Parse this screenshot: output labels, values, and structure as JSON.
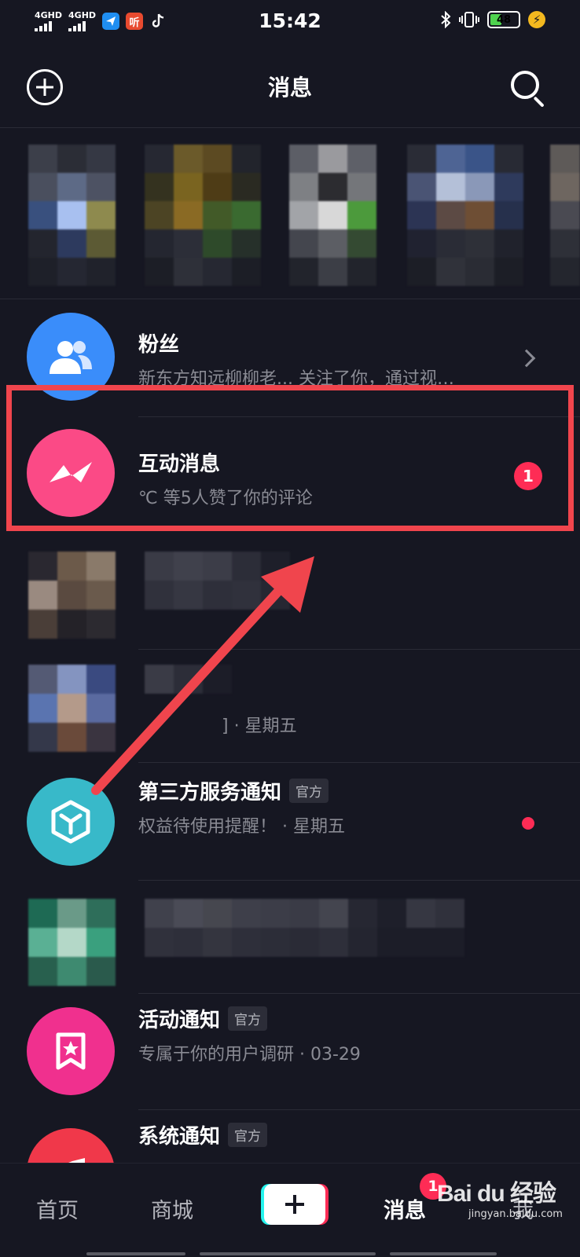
{
  "status_bar": {
    "signal_1": "4GHD",
    "signal_2": "4GHD",
    "app_badge_text": "听",
    "time": "15:42",
    "battery_level": "48",
    "battery_fraction": 0.48
  },
  "header": {
    "title": "消息"
  },
  "rows": {
    "fans": {
      "title": "粉丝",
      "subtitle": "新东方知远柳柳老... 关注了你，通过视…"
    },
    "interactions": {
      "title": "互动消息",
      "subtitle": "℃ 等5人赞了你的评论",
      "badge": "1"
    },
    "blurred_chat": {
      "subtitle": "] · 星期五"
    },
    "third_party": {
      "title": "第三方服务通知",
      "tag": "官方",
      "subtitle": "权益待使用提醒！ · 星期五"
    },
    "activity": {
      "title": "活动通知",
      "tag": "官方",
      "subtitle": "专属于你的用户调研 · 03-29"
    },
    "system": {
      "title": "系统通知",
      "tag": "官方"
    }
  },
  "bottom_nav": {
    "home": "首页",
    "mall": "商城",
    "messages": "消息",
    "messages_badge": "1",
    "me": "我"
  },
  "watermark": {
    "logo_text": "Bai du 经验",
    "url": "jingyan.baidu.com"
  },
  "colors": {
    "background": "#161722",
    "accent_red": "#fe2c55",
    "annotation_red": "#f0454d",
    "fans_blue": "#3a8dfa",
    "interaction_pink": "#fb4a86",
    "third_party_teal": "#38b9c9",
    "activity_magenta": "#f0308e"
  }
}
